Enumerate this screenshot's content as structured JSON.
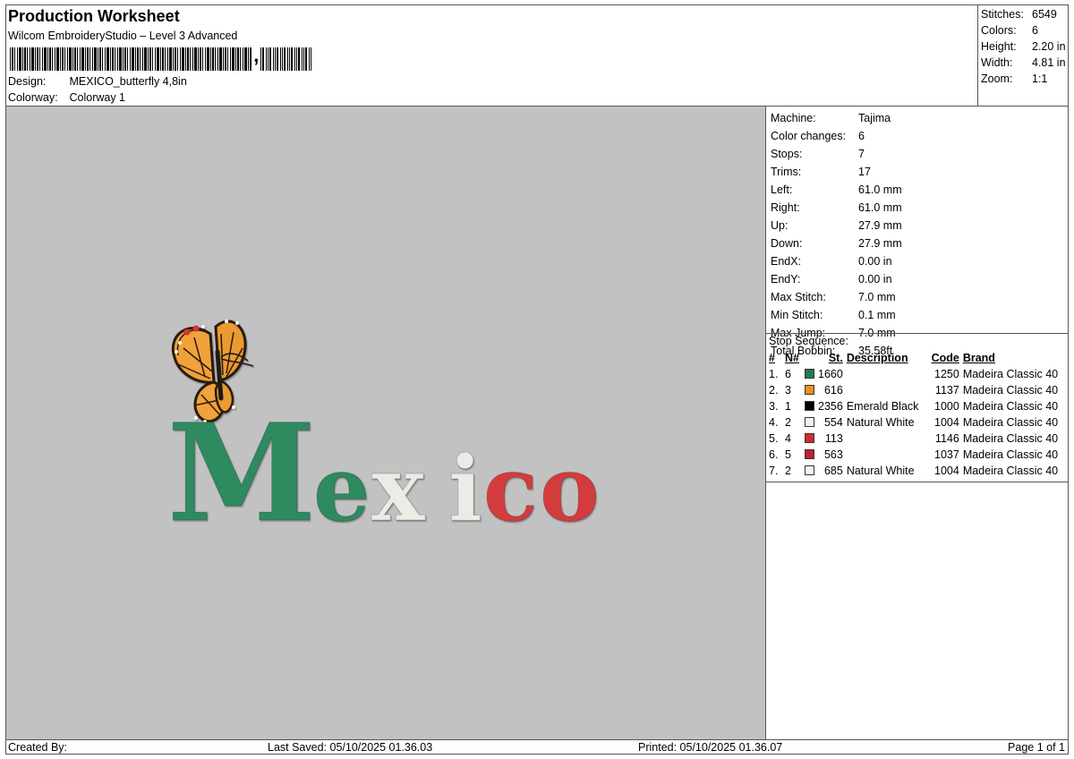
{
  "header": {
    "title": "Production Worksheet",
    "subtitle": "Wilcom EmbroideryStudio – Level 3 Advanced",
    "barcode_comma": ",",
    "design_label": "Design:",
    "design_value": "MEXICO_butterfly 4,8in",
    "colorway_label": "Colorway:",
    "colorway_value": "Colorway 1"
  },
  "stats": [
    {
      "label": "Stitches:",
      "value": "6549"
    },
    {
      "label": "Colors:",
      "value": "6"
    },
    {
      "label": "Height:",
      "value": "2.20 in"
    },
    {
      "label": "Width:",
      "value": "4.81 in"
    },
    {
      "label": "Zoom:",
      "value": "1:1"
    }
  ],
  "design_preview": {
    "text_letters": [
      "M",
      "e",
      "x",
      "i",
      "c",
      "o"
    ],
    "letter_colors": [
      "#2e8a5e",
      "#2e8a5e",
      "#ecebe6",
      "#ecebe6",
      "#d33a3d",
      "#d33a3d"
    ]
  },
  "machine_info": [
    {
      "label": "Machine:",
      "value": "Tajima"
    },
    {
      "label": "Color changes:",
      "value": "6"
    },
    {
      "label": "Stops:",
      "value": "7"
    },
    {
      "label": "Trims:",
      "value": "17"
    },
    {
      "label": "Left:",
      "value": "61.0 mm"
    },
    {
      "label": "Right:",
      "value": "61.0 mm"
    },
    {
      "label": "Up:",
      "value": "27.9 mm"
    },
    {
      "label": "Down:",
      "value": "27.9 mm"
    },
    {
      "label": "EndX:",
      "value": "0.00 in"
    },
    {
      "label": "EndY:",
      "value": "0.00 in"
    },
    {
      "label": "Max Stitch:",
      "value": "7.0 mm"
    },
    {
      "label": "Min Stitch:",
      "value": "0.1 mm"
    },
    {
      "label": "Max Jump:",
      "value": "7.0 mm"
    },
    {
      "label": "Total Bobbin:",
      "value": "35.58ft"
    }
  ],
  "stop_sequence": {
    "title": "Stop Sequence:",
    "headers": {
      "idx": "#",
      "n": "N#",
      "st": "St.",
      "desc": "Description",
      "code": "Code",
      "brand": "Brand"
    },
    "rows": [
      {
        "idx": "1.",
        "n": "6",
        "color": "#1f7a4d",
        "st": "1660",
        "desc": "",
        "code": "1250",
        "brand": "Madeira Classic 40"
      },
      {
        "idx": "2.",
        "n": "3",
        "color": "#e8901c",
        "st": "616",
        "desc": "",
        "code": "1137",
        "brand": "Madeira Classic 40"
      },
      {
        "idx": "3.",
        "n": "1",
        "color": "#000000",
        "st": "2356",
        "desc": "Emerald Black",
        "code": "1000",
        "brand": "Madeira Classic 40"
      },
      {
        "idx": "4.",
        "n": "2",
        "color": "#f2f2f2",
        "st": "554",
        "desc": "Natural White",
        "code": "1004",
        "brand": "Madeira Classic 40"
      },
      {
        "idx": "5.",
        "n": "4",
        "color": "#d42a2a",
        "st": "113",
        "desc": "",
        "code": "1146",
        "brand": "Madeira Classic 40"
      },
      {
        "idx": "6.",
        "n": "5",
        "color": "#c4202b",
        "st": "563",
        "desc": "",
        "code": "1037",
        "brand": "Madeira Classic 40"
      },
      {
        "idx": "7.",
        "n": "2",
        "color": "#f2f2f2",
        "st": "685",
        "desc": "Natural White",
        "code": "1004",
        "brand": "Madeira Classic 40"
      }
    ]
  },
  "footer": {
    "created_by": "Created By:",
    "last_saved": "Last Saved: 05/10/2025 01.36.03",
    "printed": "Printed: 05/10/2025 01.36.07",
    "page": "Page 1 of 1"
  }
}
